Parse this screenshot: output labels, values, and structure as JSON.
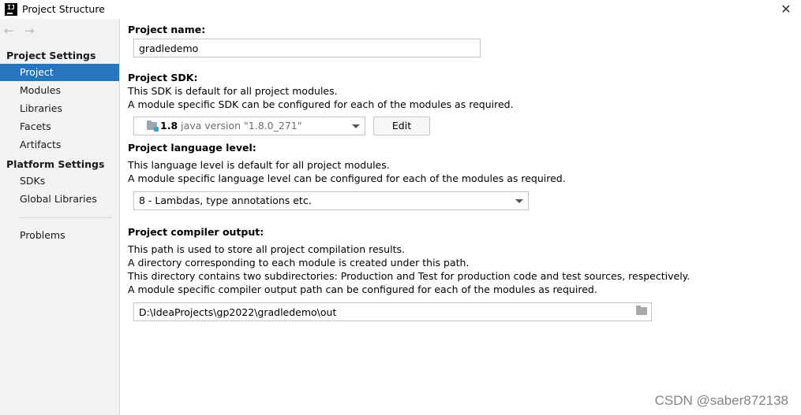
{
  "window": {
    "title": "Project Structure",
    "app_icon_label": "IJ"
  },
  "sidebar": {
    "nav_back": "←",
    "nav_forward": "→",
    "project_settings_title": "Project Settings",
    "project_settings_items": [
      {
        "label": "Project",
        "selected": true
      },
      {
        "label": "Modules"
      },
      {
        "label": "Libraries"
      },
      {
        "label": "Facets"
      },
      {
        "label": "Artifacts"
      }
    ],
    "platform_settings_title": "Platform Settings",
    "platform_settings_items": [
      {
        "label": "SDKs"
      },
      {
        "label": "Global Libraries"
      }
    ],
    "problems_label": "Problems"
  },
  "main": {
    "project_name": {
      "label": "Project name:",
      "value": "gradledemo"
    },
    "project_sdk": {
      "label": "Project SDK:",
      "desc_line1": "This SDK is default for all project modules.",
      "desc_line2": "A module specific SDK can be configured for each of the modules as required.",
      "selected_version": "1.8",
      "selected_detail": "java version \"1.8.0_271\"",
      "edit_label": "Edit"
    },
    "language_level": {
      "label": "Project language level:",
      "desc_line1": "This language level is default for all project modules.",
      "desc_line2": "A module specific language level can be configured for each of the modules as required.",
      "selected": "8 - Lambdas, type annotations etc."
    },
    "compiler_output": {
      "label": "Project compiler output:",
      "desc_line1": "This path is used to store all project compilation results.",
      "desc_line2": "A directory corresponding to each module is created under this path.",
      "desc_line3": "This directory contains two subdirectories: Production and Test for production code and test sources, respectively.",
      "desc_line4": "A module specific compiler output path can be configured for each of the modules as required.",
      "path": "D:\\IdeaProjects\\gp2022\\gradledemo\\out"
    }
  },
  "watermark": "CSDN @saber872138",
  "colors": {
    "selection": "#2675bf",
    "sidebar_bg": "#f2f2f2"
  }
}
